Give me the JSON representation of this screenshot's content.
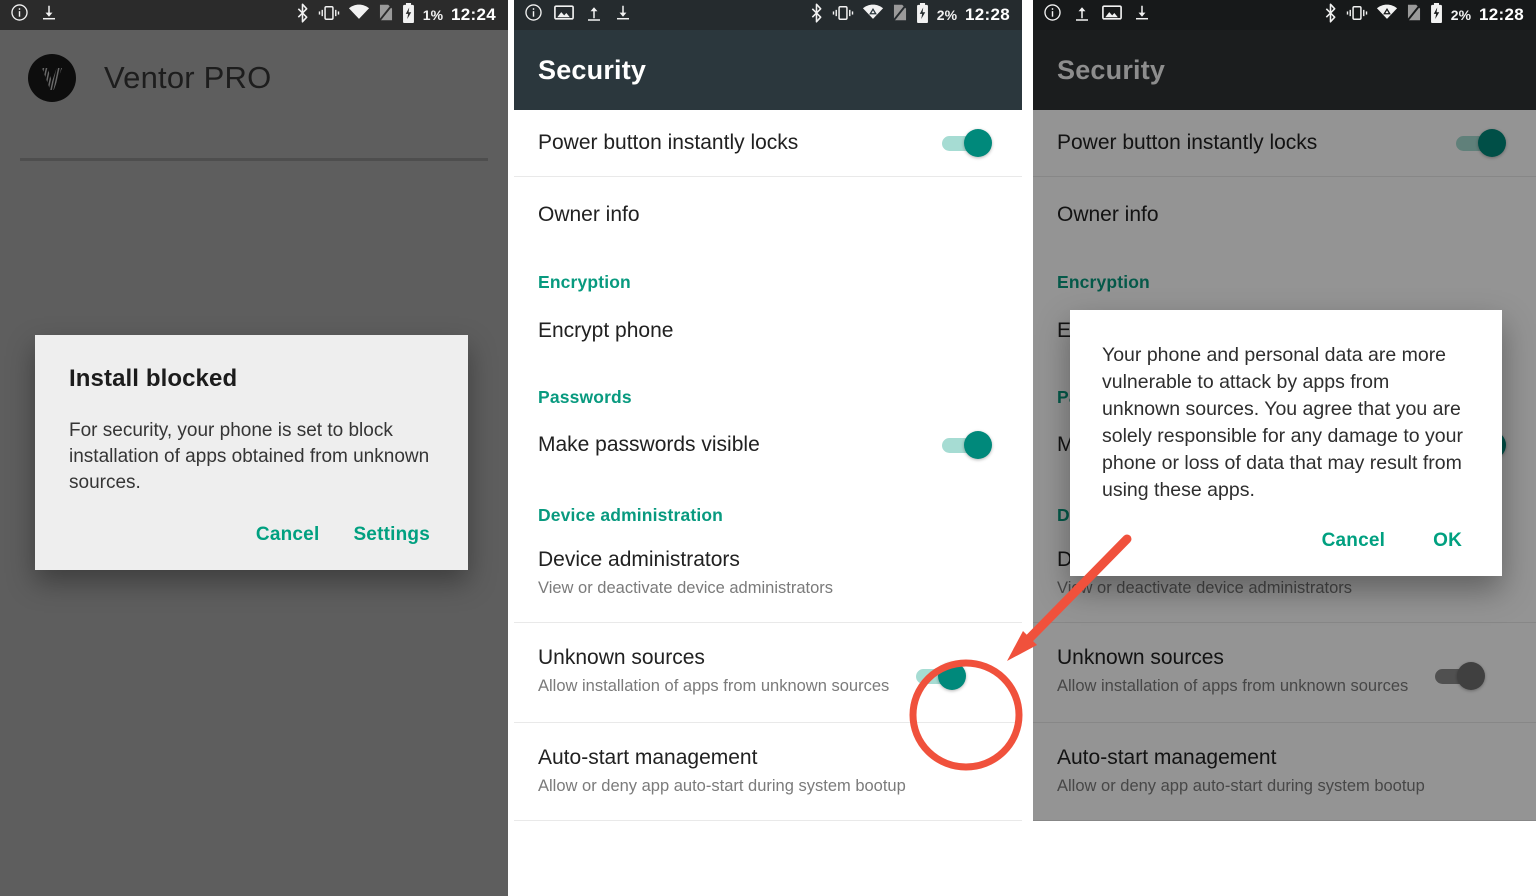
{
  "panel1": {
    "statusbar": {
      "left_icons": [
        "info-circle-icon",
        "download-icon"
      ],
      "right_icons": [
        "bluetooth-icon",
        "vibrate-icon",
        "wifi-icon",
        "sim-missing-icon",
        "battery-charging-icon"
      ],
      "battery": "1%",
      "clock": "12:24"
    },
    "app": {
      "logo": "ventor-logo-icon",
      "title": "Ventor PRO"
    },
    "dialog": {
      "title": "Install blocked",
      "body": "For security, your phone is set to block installation of apps obtained from unknown sources.",
      "cancel_label": "Cancel",
      "settings_label": "Settings"
    }
  },
  "panel2": {
    "statusbar": {
      "left_icons": [
        "info-circle-icon",
        "image-icon",
        "upload-icon",
        "download-icon"
      ],
      "right_icons": [
        "bluetooth-icon",
        "vibrate-icon",
        "wifi-vpn-icon",
        "sim-missing-icon",
        "battery-charging-icon"
      ],
      "battery": "2%",
      "clock": "12:28"
    },
    "appbar": {
      "title": "Security"
    },
    "rows": [
      {
        "type": "switch",
        "title": "Power button instantly locks",
        "sub": "",
        "state": "on"
      },
      {
        "type": "item",
        "title": "Owner info",
        "sub": ""
      },
      {
        "type": "section",
        "title": "Encryption"
      },
      {
        "type": "item",
        "title": "Encrypt phone",
        "sub": ""
      },
      {
        "type": "section",
        "title": "Passwords"
      },
      {
        "type": "switch",
        "title": "Make passwords visible",
        "sub": "",
        "state": "on"
      },
      {
        "type": "section",
        "title": "Device administration"
      },
      {
        "type": "item",
        "title": "Device administrators",
        "sub": "View or deactivate device administrators"
      },
      {
        "type": "switch",
        "title": "Unknown sources",
        "sub": "Allow installation of apps from unknown sources",
        "state": "on"
      },
      {
        "type": "item",
        "title": "Auto-start management",
        "sub": "Allow or deny app auto-start during system bootup"
      }
    ]
  },
  "panel3": {
    "statusbar": {
      "left_icons": [
        "info-circle-icon",
        "upload-icon",
        "image-icon",
        "download-icon"
      ],
      "right_icons": [
        "bluetooth-icon",
        "vibrate-icon",
        "wifi-vpn-icon",
        "sim-missing-icon",
        "battery-charging-icon"
      ],
      "battery": "2%",
      "clock": "12:28"
    },
    "appbar": {
      "title": "Security"
    },
    "rows": [
      {
        "type": "switch",
        "title": "Power button instantly locks",
        "sub": "",
        "state": "on"
      },
      {
        "type": "item",
        "title": "Owner info",
        "sub": ""
      },
      {
        "type": "section",
        "title": "Encryption"
      },
      {
        "type": "item",
        "title": "Encrypt phone",
        "sub": ""
      },
      {
        "type": "section",
        "title": "Passwords"
      },
      {
        "type": "switch",
        "title": "Make passwords visible",
        "sub": "",
        "state": "on"
      },
      {
        "type": "section",
        "title": "Device administration"
      },
      {
        "type": "item",
        "title": "Device administrators",
        "sub": "View or deactivate device administrators"
      },
      {
        "type": "switch",
        "title": "Unknown sources",
        "sub": "Allow installation of apps from unknown sources",
        "state": "off"
      },
      {
        "type": "item",
        "title": "Auto-start management",
        "sub": "Allow or deny app auto-start during system bootup"
      }
    ],
    "dialog": {
      "body": "Your phone and personal data are more vulnerable to attack by apps from unknown sources. You agree that you are solely responsible for any damage to your phone or loss of data that may result from using these apps.",
      "cancel_label": "Cancel",
      "ok_label": "OK"
    }
  },
  "annotations": {
    "highlight_circle": "unknown-sources-toggle-highlight",
    "arrow": "pointer-arrow"
  },
  "colors": {
    "accent_teal": "#089a7f",
    "switch_on": "#00897b",
    "switch_track_on": "#a6dcd3",
    "annotation_red": "#f0513c",
    "appbar2": "#2b373d",
    "scrim": "#5e5e5e"
  }
}
